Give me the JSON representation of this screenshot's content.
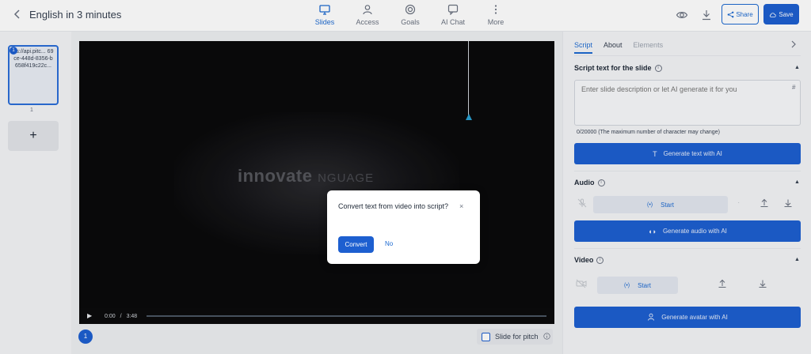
{
  "header": {
    "title": "English in 3 minutes",
    "nav": [
      {
        "label": "Slides",
        "icon": "monitor-icon"
      },
      {
        "label": "Access",
        "icon": "user-icon"
      },
      {
        "label": "Goals",
        "icon": "target-icon"
      },
      {
        "label": "AI Chat",
        "icon": "chat-icon"
      },
      {
        "label": "More",
        "icon": "more-vertical-icon"
      }
    ],
    "active_nav": "Slides",
    "share_label": "Share",
    "save_label": "Save"
  },
  "slides": {
    "thumb_text": "ps://api.pitc... 69ce-448d-8356-b658f419c22c...",
    "thumb_badge": "1",
    "number": "1",
    "add_label": "+"
  },
  "video": {
    "logo_main": "innovate",
    "logo_sub": "NGUAGE",
    "time_current": "0:00",
    "time_sep": "/",
    "time_total": "3:48",
    "progress_fraction": 0.0
  },
  "stage": {
    "page_badge": "1",
    "pitch_label": "Slide for pitch",
    "pitch_info": "i"
  },
  "panel": {
    "tabs": [
      {
        "label": "Script",
        "state": "active"
      },
      {
        "label": "About",
        "state": "normal"
      },
      {
        "label": "Elements",
        "state": "disabled"
      }
    ],
    "script": {
      "heading": "Script text for the slide",
      "placeholder": "Enter slide description or let AI generate it for you",
      "hash": "#",
      "char_count": "0/20000 (The maximum number of character may change)",
      "generate_label": "Generate text with AI"
    },
    "audio": {
      "heading": "Audio",
      "start_label": "Start",
      "generate_label": "Generate audio with AI"
    },
    "video": {
      "heading": "Video",
      "start_label": "Start",
      "generate_label": "Generate avatar with AI"
    }
  },
  "modal": {
    "title": "Convert text from video into script?",
    "close": "×",
    "convert_label": "Convert",
    "no_label": "No"
  },
  "colors": {
    "accent": "#1d5fd0",
    "link": "#1d6ad1"
  }
}
